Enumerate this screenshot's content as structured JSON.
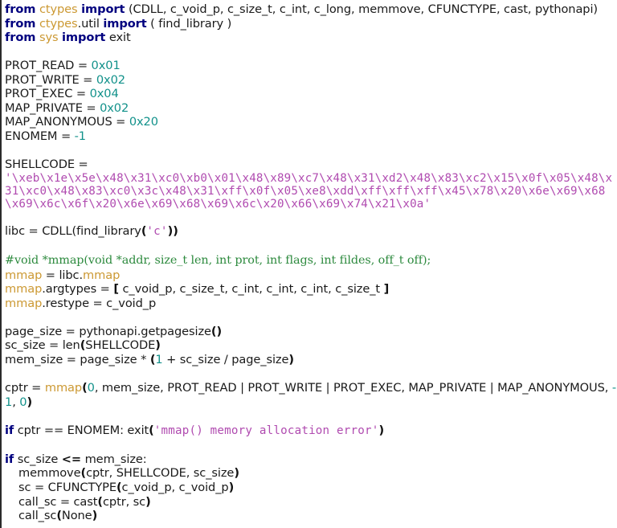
{
  "editor": {
    "language": "python",
    "background": "#ffffff",
    "default_text_color": "#1a1a1a",
    "palette": {
      "keyword": "#00007f",
      "module": "#cc9933",
      "number": "#11918a",
      "string": "#b04bb0",
      "comment": "#2d8a3e",
      "punctuation": "#111111"
    }
  },
  "code": {
    "l1": {
      "kw_from": "from",
      "mod": "ctypes",
      "kw_import": "import",
      "rest": "(CDLL, c_void_p, c_size_t, c_int, c_long, memmove, CFUNCTYPE, cast, pythonapi)"
    },
    "l2": {
      "kw_from": "from",
      "mod": "ctypes",
      "mod_tail": ".util",
      "kw_import": "import",
      "rest": "( find_library )"
    },
    "l3": {
      "kw_from": "from",
      "mod": "sys",
      "kw_import": "import",
      "rest": "exit"
    },
    "l5": {
      "name": "PROT_READ = ",
      "value": "0x01"
    },
    "l6": {
      "name": "PROT_WRITE = ",
      "value": "0x02"
    },
    "l7": {
      "name": "PROT_EXEC = ",
      "value": "0x04"
    },
    "l8": {
      "name": "MAP_PRIVATE = ",
      "value": "0x02"
    },
    "l9": {
      "name": "MAP_ANONYMOUS = ",
      "value": "0x20"
    },
    "l10": {
      "name": "ENOMEM = ",
      "value": "-1"
    },
    "l12": {
      "text": "SHELLCODE ="
    },
    "l13": {
      "string": "'\\xeb\\x1e\\x5e\\x48\\x31\\xc0\\xb0\\x01\\x48\\x89\\xc7\\x48\\x31\\xd2\\x48\\x83\\xc2\\x15\\x0f\\x05\\x48\\x31\\xc0\\x48\\x83\\xc0\\x3c\\x48\\x31\\xff\\x0f\\x05\\xe8\\xdd\\xff\\xff\\xff\\x45\\x78\\x20\\x6e\\x69\\x68\\x69\\x6c\\x6f\\x20\\x6e\\x69\\x68\\x69\\x6c\\x20\\x66\\x69\\x74\\x21\\x0a'"
    },
    "l15": {
      "pre": "libc = CDLL(find_library",
      "p1": "(",
      "str": "'c'",
      "p2": "))"
    },
    "l17": {
      "comment": "#void *mmap(void *addr, size_t len, int prot, int flags, int fildes, off_t off);"
    },
    "l18": {
      "mod": "mmap",
      "mid": " = libc.",
      "mod2": "mmap"
    },
    "l19": {
      "mod": "mmap",
      "attr": ".argtypes = ",
      "br_open": "[",
      "items": " c_void_p, c_size_t, c_int, c_int, c_int, c_size_t ",
      "br_close": "]"
    },
    "l20": {
      "mod": "mmap",
      "attr": ".restype = c_void_p"
    },
    "l22": {
      "pre": "page_size = pythonapi.getpagesize",
      "pun": "()"
    },
    "l23": {
      "pre": "sc_size = len",
      "p1": "(",
      "mid": "SHELLCODE",
      "p2": ")"
    },
    "l24": {
      "pre": "mem_size = page_size * ",
      "p1": "(",
      "num": "1",
      "mid": " + sc_size / page_size",
      "p2": ")"
    },
    "l26": {
      "pre": "cptr = ",
      "mod": "mmap",
      "p1": "(",
      "num0": "0",
      "mid": ", mem_size, PROT_READ | PROT_WRITE | PROT_EXEC, MAP_PRIVATE | MAP_ANONYMOUS, ",
      "num1": "-1",
      "mid2": ", ",
      "num2": "0",
      "p2": ")"
    },
    "l28": {
      "kw": "if",
      "mid": " cptr == ENOMEM: exit",
      "p1": "(",
      "str": "'mmap() memory allocation error'",
      "p2": ")"
    },
    "l30": {
      "kw": "if",
      "mid": " sc_size ",
      "op": "<=",
      "tail": " mem_size:"
    },
    "l31": {
      "pre": "memmove",
      "p1": "(",
      "mid": "cptr, SHELLCODE, sc_size",
      "p2": ")"
    },
    "l32": {
      "pre": "sc = CFUNCTYPE",
      "p1": "(",
      "mid": "c_void_p, c_void_p",
      "p2": ")"
    },
    "l33": {
      "pre": "call_sc = cast",
      "p1": "(",
      "mid": "cptr, sc",
      "p2": ")"
    },
    "l34": {
      "pre": "call_sc",
      "p1": "(",
      "mid": "None",
      "p2": ")"
    }
  }
}
